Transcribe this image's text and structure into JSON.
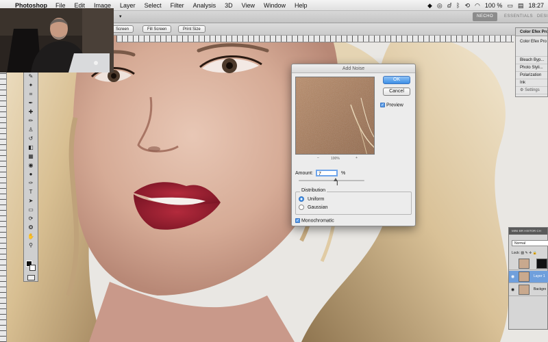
{
  "menubar": {
    "app_name": "Photoshop",
    "items": [
      "File",
      "Edit",
      "Image",
      "Layer",
      "Select",
      "Filter",
      "Analysis",
      "3D",
      "View",
      "Window",
      "Help"
    ],
    "battery": "100 %",
    "clock": "18:27"
  },
  "options_bar": {
    "buttons": [
      "Screen",
      "Fill Screen",
      "Print Size"
    ]
  },
  "workspaces": [
    "NECHO",
    "ESSENTIALS",
    "DESIGN"
  ],
  "color_efex": {
    "title": "Color Efex Pro",
    "header": "Color Efex Pro",
    "filters": [
      "Bleach Byp...",
      "Photo Styli...",
      "Polarization",
      "Ink"
    ],
    "settings": "Settings"
  },
  "layers_panel": {
    "tabs": "MINI BR HISTOR CH",
    "blend_mode": "Normal",
    "lock_label": "Lock:",
    "layers": [
      {
        "name": ""
      },
      {
        "name": "Layer 1"
      },
      {
        "name": "Backgro"
      }
    ]
  },
  "dialog": {
    "title": "Add Noise",
    "ok_label": "OK",
    "cancel_label": "Cancel",
    "preview_label": "Preview",
    "preview_checked": true,
    "zoom_minus": "–",
    "zoom_percent": "100%",
    "zoom_plus": "+",
    "amount_label": "Amount:",
    "amount_value": "7",
    "amount_unit": "%",
    "amount_fraction": 0.56,
    "distribution_label": "Distribution",
    "options": [
      "Uniform",
      "Gaussian"
    ],
    "selected_option": "Uniform",
    "monochromatic_label": "Monochromatic",
    "monochromatic_checked": true
  },
  "colors": {
    "accent": "#3d8fe6",
    "selection": "#6f9fdc",
    "lips": "#9b1f30"
  }
}
